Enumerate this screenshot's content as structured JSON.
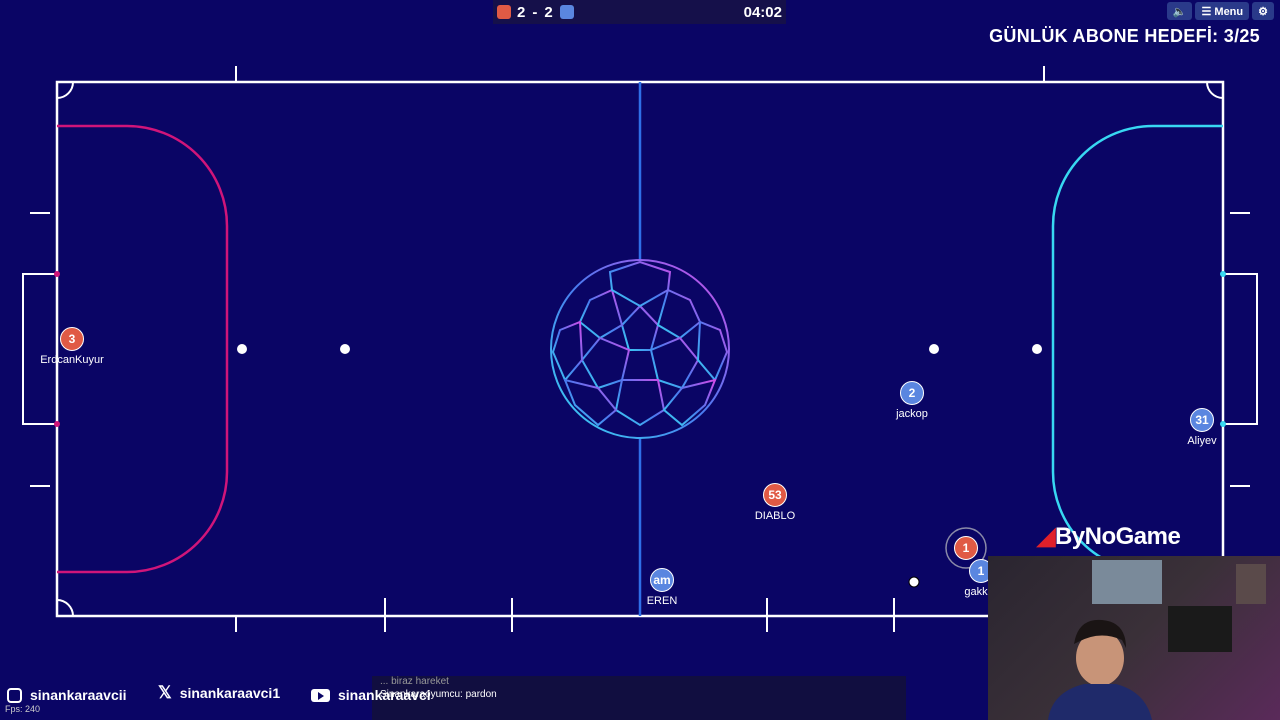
{
  "score": {
    "red_score": "2",
    "separator": "-",
    "blue_score": "2",
    "red_color": "#e05a45",
    "blue_color": "#5a86e0"
  },
  "timer": "04:02",
  "controls": {
    "sound_icon": "speaker-icon",
    "menu_label": "☰ Menu",
    "settings_icon": "gear-icon"
  },
  "overlay": {
    "goal_text": "GÜNLÜK ABONE HEDEFİ: 3/25",
    "brand": "ByNoGame",
    "fps": "Fps: 240"
  },
  "players": [
    {
      "number": "3",
      "name": "ErdcanKuyur",
      "team": "red"
    },
    {
      "number": "2",
      "name": "jackop",
      "team": "blue"
    },
    {
      "number": "31",
      "name": "Aliyev",
      "team": "blue"
    },
    {
      "number": "53",
      "name": "DIABLO",
      "team": "red"
    },
    {
      "number": "am",
      "name": "EREN",
      "team": "blue"
    },
    {
      "number": "1",
      "name": "",
      "team": "red"
    },
    {
      "number": "1",
      "name": "gakk",
      "team": "blue"
    }
  ],
  "social": [
    {
      "icon": "instagram-icon",
      "handle": "sinankaraavcii"
    },
    {
      "icon": "x-icon",
      "handle": "sinankaraavci1"
    },
    {
      "icon": "youtube-icon",
      "handle": "sinankaraavci"
    }
  ],
  "chat": {
    "line1": "... biraz hareket",
    "line2": "Sinankaraoyumcu: pardon"
  },
  "field_colors": {
    "background": "#0a0565",
    "red_arc": "#d0157a",
    "cyan_arc": "#38d8f2",
    "midline": "#2f6fe8"
  }
}
